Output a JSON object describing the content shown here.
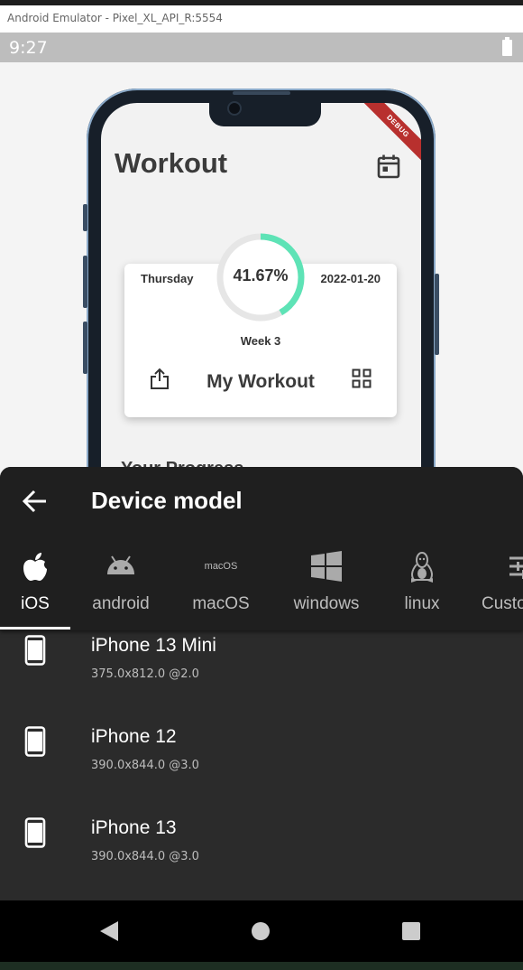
{
  "window": {
    "title": "Android Emulator - Pixel_XL_API_R:5554"
  },
  "status_bar": {
    "time": "9:27",
    "battery_icon": "battery-full-icon"
  },
  "preview_app": {
    "debug_banner": "DEBUG",
    "title": "Workout",
    "calendar_icon": "calendar-icon",
    "card": {
      "day": "Thursday",
      "date": "2022-01-20",
      "progress_text": "41.67%",
      "progress": 0.4167,
      "week": "Week 3",
      "workout_name": "My Workout",
      "accent_color": "#5ee3b6"
    },
    "section_peek": "Your Progress"
  },
  "sheet": {
    "title": "Device model",
    "tabs": [
      {
        "label": "iOS",
        "icon": "apple-icon",
        "active": true
      },
      {
        "label": "android",
        "icon": "android-icon",
        "active": false
      },
      {
        "label": "macOS",
        "icon_text": "macOS",
        "active": false
      },
      {
        "label": "windows",
        "icon": "windows-icon",
        "active": false
      },
      {
        "label": "linux",
        "icon": "linux-icon",
        "active": false
      },
      {
        "label": "Custom",
        "icon": "tune-icon",
        "active": false
      }
    ],
    "devices": [
      {
        "name": "iPhone 13 Mini",
        "spec": "375.0x812.0 @2.0"
      },
      {
        "name": "iPhone 12",
        "spec": "390.0x844.0 @3.0"
      },
      {
        "name": "iPhone 13",
        "spec": "390.0x844.0 @3.0"
      }
    ]
  },
  "nav": {
    "back": "back-triangle-icon",
    "home": "home-circle-icon",
    "recents": "recents-square-icon"
  }
}
